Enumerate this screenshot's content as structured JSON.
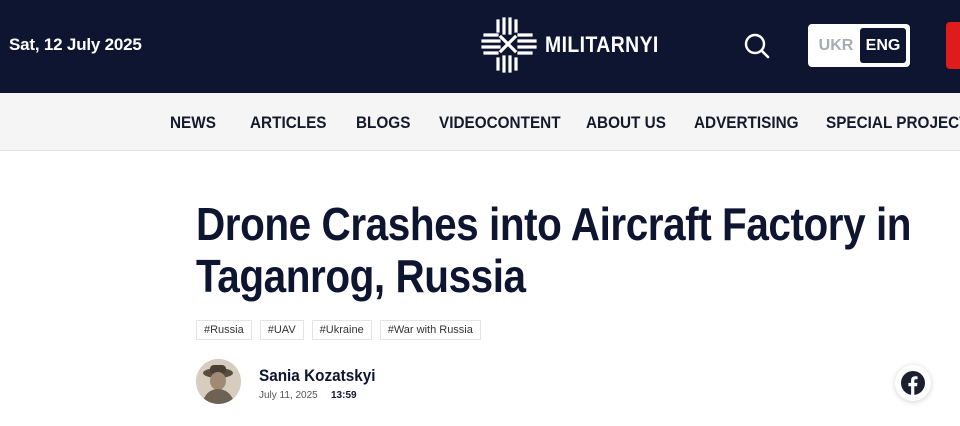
{
  "header": {
    "date": "Sat, 12 July 2025",
    "logo_text": "MILITARNYI",
    "lang": {
      "ukr": "UKR",
      "eng": "ENG",
      "active": "ENG"
    }
  },
  "nav": {
    "items": [
      "NEWS",
      "ARTICLES",
      "BLOGS",
      "VIDEOCONTENT",
      "ABOUT US",
      "ADVERTISING",
      "SPECIAL PROJECTS"
    ]
  },
  "article": {
    "title_line1": "Drone Crashes into Aircraft Factory in",
    "title_line2": "Taganrog, Russia",
    "tags": [
      "#Russia",
      "#UAV",
      "#Ukraine",
      "#War with Russia"
    ],
    "author": "Sania Kozatskyi",
    "date": "July 11, 2025",
    "time": "13:59"
  },
  "icons": {
    "search": "search-icon",
    "facebook": "facebook-icon",
    "logo": "militarnyi-logo-icon"
  },
  "colors": {
    "header_bg": "#0d1530",
    "accent_red": "#e01b1b",
    "facebook": "#1b1f2e"
  }
}
